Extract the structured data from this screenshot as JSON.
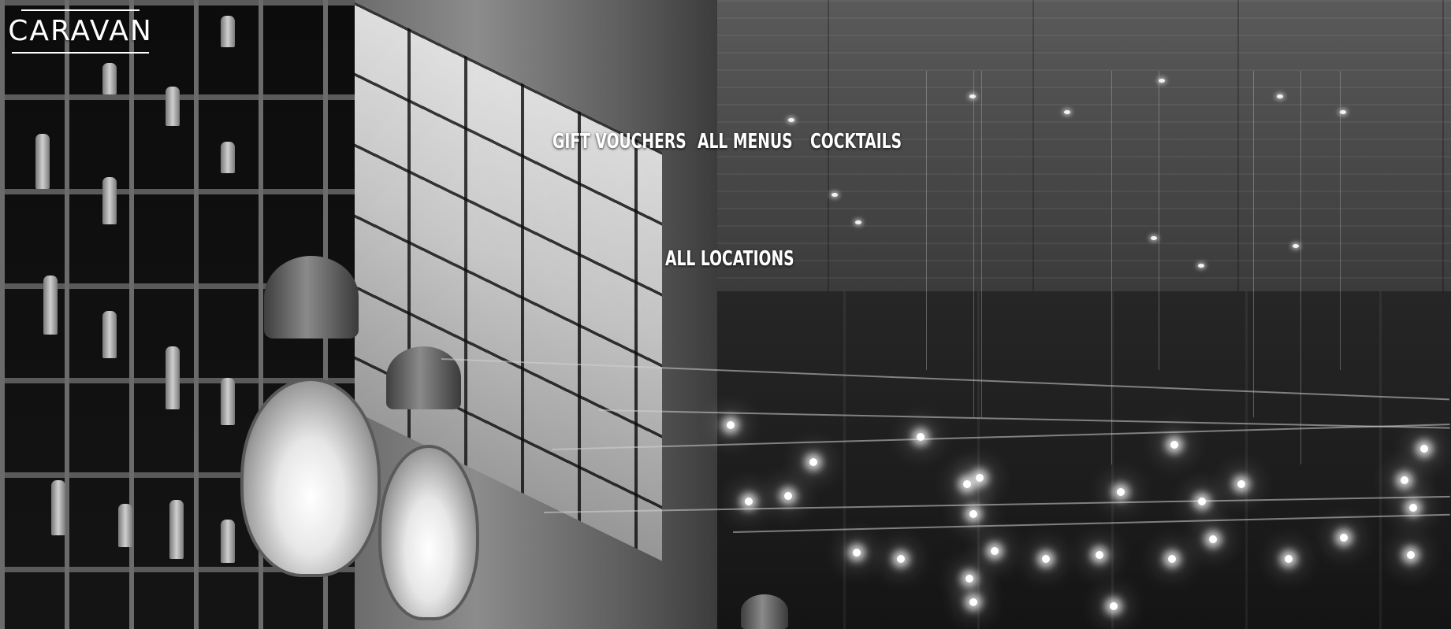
{
  "brand": {
    "logo_text": "CARAVAN"
  },
  "nav": {
    "items": [
      {
        "label": "GIFT VOUCHERS"
      },
      {
        "label": "ALL MENUS"
      },
      {
        "label": "COCKTAILS"
      },
      {
        "label": "ALL LOCATIONS"
      }
    ]
  },
  "hero": {
    "image": "black-and-white restaurant bar interior with bottle shelves, industrial cage lamps and strings of hanging pendant lights"
  },
  "colors": {
    "nav_text": "#ffffff",
    "logo": "#ffffff"
  }
}
